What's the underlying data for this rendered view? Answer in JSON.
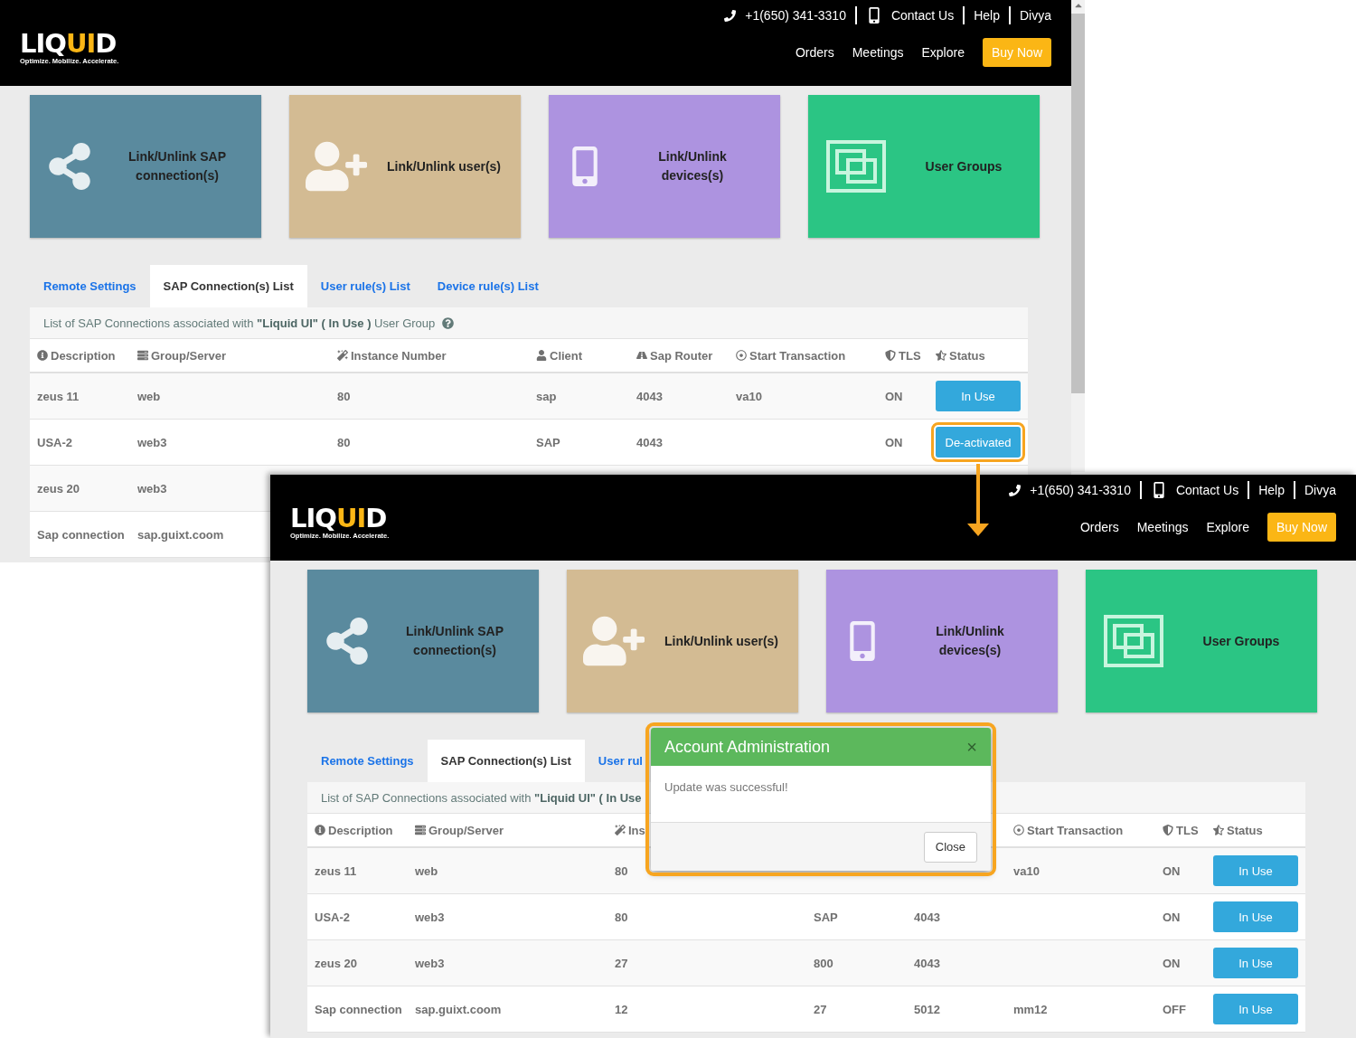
{
  "shots": [
    {
      "header": {
        "logo": {
          "parts": [
            {
              "text": "LIQ",
              "accent": false
            },
            {
              "text": "UI",
              "accent": true
            },
            {
              "text": "D",
              "accent": false
            }
          ],
          "tagline": "Optimize. Mobilize. Accelerate."
        },
        "phone": "+1(650) 341-3310",
        "contact": "Contact Us",
        "help": "Help",
        "user": "Divya",
        "nav": [
          "Orders",
          "Meetings",
          "Explore"
        ],
        "buy": "Buy Now"
      },
      "scrollbar": true,
      "tiles": [
        {
          "kind": "share",
          "label": "Link/Unlink SAP\nconnection(s)",
          "color": "#5a8a9e"
        },
        {
          "kind": "user-add",
          "label": "Link/Unlink user(s)",
          "color": "#d3bb93"
        },
        {
          "kind": "mobile",
          "label": "Link/Unlink\ndevices(s)",
          "color": "#ad93e0"
        },
        {
          "kind": "groups",
          "label": "User Groups",
          "color": "#2bc584"
        }
      ],
      "tabs": [
        {
          "label": "Remote Settings",
          "selected": false
        },
        {
          "label": "SAP Connection(s) List",
          "selected": true
        },
        {
          "label": "User rule(s) List",
          "selected": false
        },
        {
          "label": "Device rule(s) List",
          "selected": false
        }
      ],
      "subtitle": "List of SAP Connections associated with **\"Liquid UI\" ( In Use )** User Group",
      "help_icon": true,
      "columns": [
        {
          "kind": "description",
          "label": "Description"
        },
        {
          "kind": "group",
          "label": "Group/Server"
        },
        {
          "kind": "instance",
          "label": "Instance Number"
        },
        {
          "kind": "client",
          "label": "Client"
        },
        {
          "kind": "router",
          "label": "Sap Router"
        },
        {
          "kind": "transaction",
          "label": "Start Transaction"
        },
        {
          "kind": "tls",
          "label": "TLS"
        },
        {
          "kind": "status",
          "label": "Status"
        }
      ],
      "rows": [
        {
          "cells": {
            "description": "zeus 11",
            "group": "web",
            "instance": "80",
            "client": "sap",
            "router": "4043",
            "transaction": "va10",
            "tls": "ON"
          },
          "status": {
            "label": "In Use",
            "highlighted": false
          }
        },
        {
          "cells": {
            "description": "USA-2",
            "group": "web3",
            "instance": "80",
            "client": "SAP",
            "router": "4043",
            "tls": "ON"
          },
          "status": {
            "label": "De-activated",
            "highlighted": true
          }
        },
        {
          "cells": {
            "description": "zeus 20",
            "group": "web3"
          }
        },
        {
          "cells": {
            "description": "Sap connection",
            "group": "sap.guixt.coom"
          }
        }
      ]
    },
    {
      "header": {
        "logo": {
          "parts": [
            {
              "text": "LIQ",
              "accent": false
            },
            {
              "text": "UI",
              "accent": true
            },
            {
              "text": "D",
              "accent": false
            }
          ],
          "tagline": "Optimize. Mobilize. Accelerate."
        },
        "phone": "+1(650) 341-3310",
        "contact": "Contact Us",
        "help": "Help",
        "user": "Divya",
        "nav": [
          "Orders",
          "Meetings",
          "Explore"
        ],
        "buy": "Buy Now"
      },
      "tiles": [
        {
          "kind": "share",
          "label": "Link/Unlink SAP\nconnection(s)",
          "color": "#5a8a9e"
        },
        {
          "kind": "user-add",
          "label": "Link/Unlink user(s)",
          "color": "#d3bb93"
        },
        {
          "kind": "mobile",
          "label": "Link/Unlink\ndevices(s)",
          "color": "#ad93e0"
        },
        {
          "kind": "groups",
          "label": "User Groups",
          "color": "#2bc584"
        }
      ],
      "tabs": [
        {
          "label": "Remote Settings",
          "selected": false
        },
        {
          "label": "SAP Connection(s) List",
          "selected": true
        },
        {
          "label": "User rul",
          "selected": false
        }
      ],
      "subtitle": "List of SAP Connections associated with **\"Liquid UI\" ( In Use**",
      "columns": [
        {
          "kind": "description",
          "label": "Description"
        },
        {
          "kind": "group",
          "label": "Group/Server"
        },
        {
          "kind": "instance",
          "label": "Ins"
        },
        {
          "kind": "transaction",
          "label": "Start Transaction"
        },
        {
          "kind": "tls",
          "label": "TLS"
        },
        {
          "kind": "status",
          "label": "Status"
        }
      ],
      "rows": [
        {
          "cells": {
            "description": "zeus 11",
            "group": "web",
            "instance": "80",
            "transaction": "va10",
            "tls": "ON"
          },
          "status": {
            "label": "In Use",
            "highlighted": false
          }
        },
        {
          "cells": {
            "description": "USA-2",
            "group": "web3",
            "instance": "80",
            "client": "SAP",
            "router": "4043",
            "tls": "ON"
          },
          "status": {
            "label": "In Use",
            "highlighted": false
          }
        },
        {
          "cells": {
            "description": "zeus 20",
            "group": "web3",
            "instance": "27",
            "client": "800",
            "router": "4043",
            "tls": "ON"
          },
          "status": {
            "label": "In Use",
            "highlighted": false
          }
        },
        {
          "cells": {
            "description": "Sap connection",
            "group": "sap.guixt.coom",
            "instance": "12",
            "client": "27",
            "router": "5012",
            "transaction": "mm12",
            "tls": "OFF"
          },
          "status": {
            "label": "In Use",
            "highlighted": false
          }
        }
      ],
      "modal": {
        "title": "Account Administration",
        "close_symbol": "×",
        "message": "Update was successful!",
        "button": "Close",
        "highlighted": true
      }
    }
  ]
}
